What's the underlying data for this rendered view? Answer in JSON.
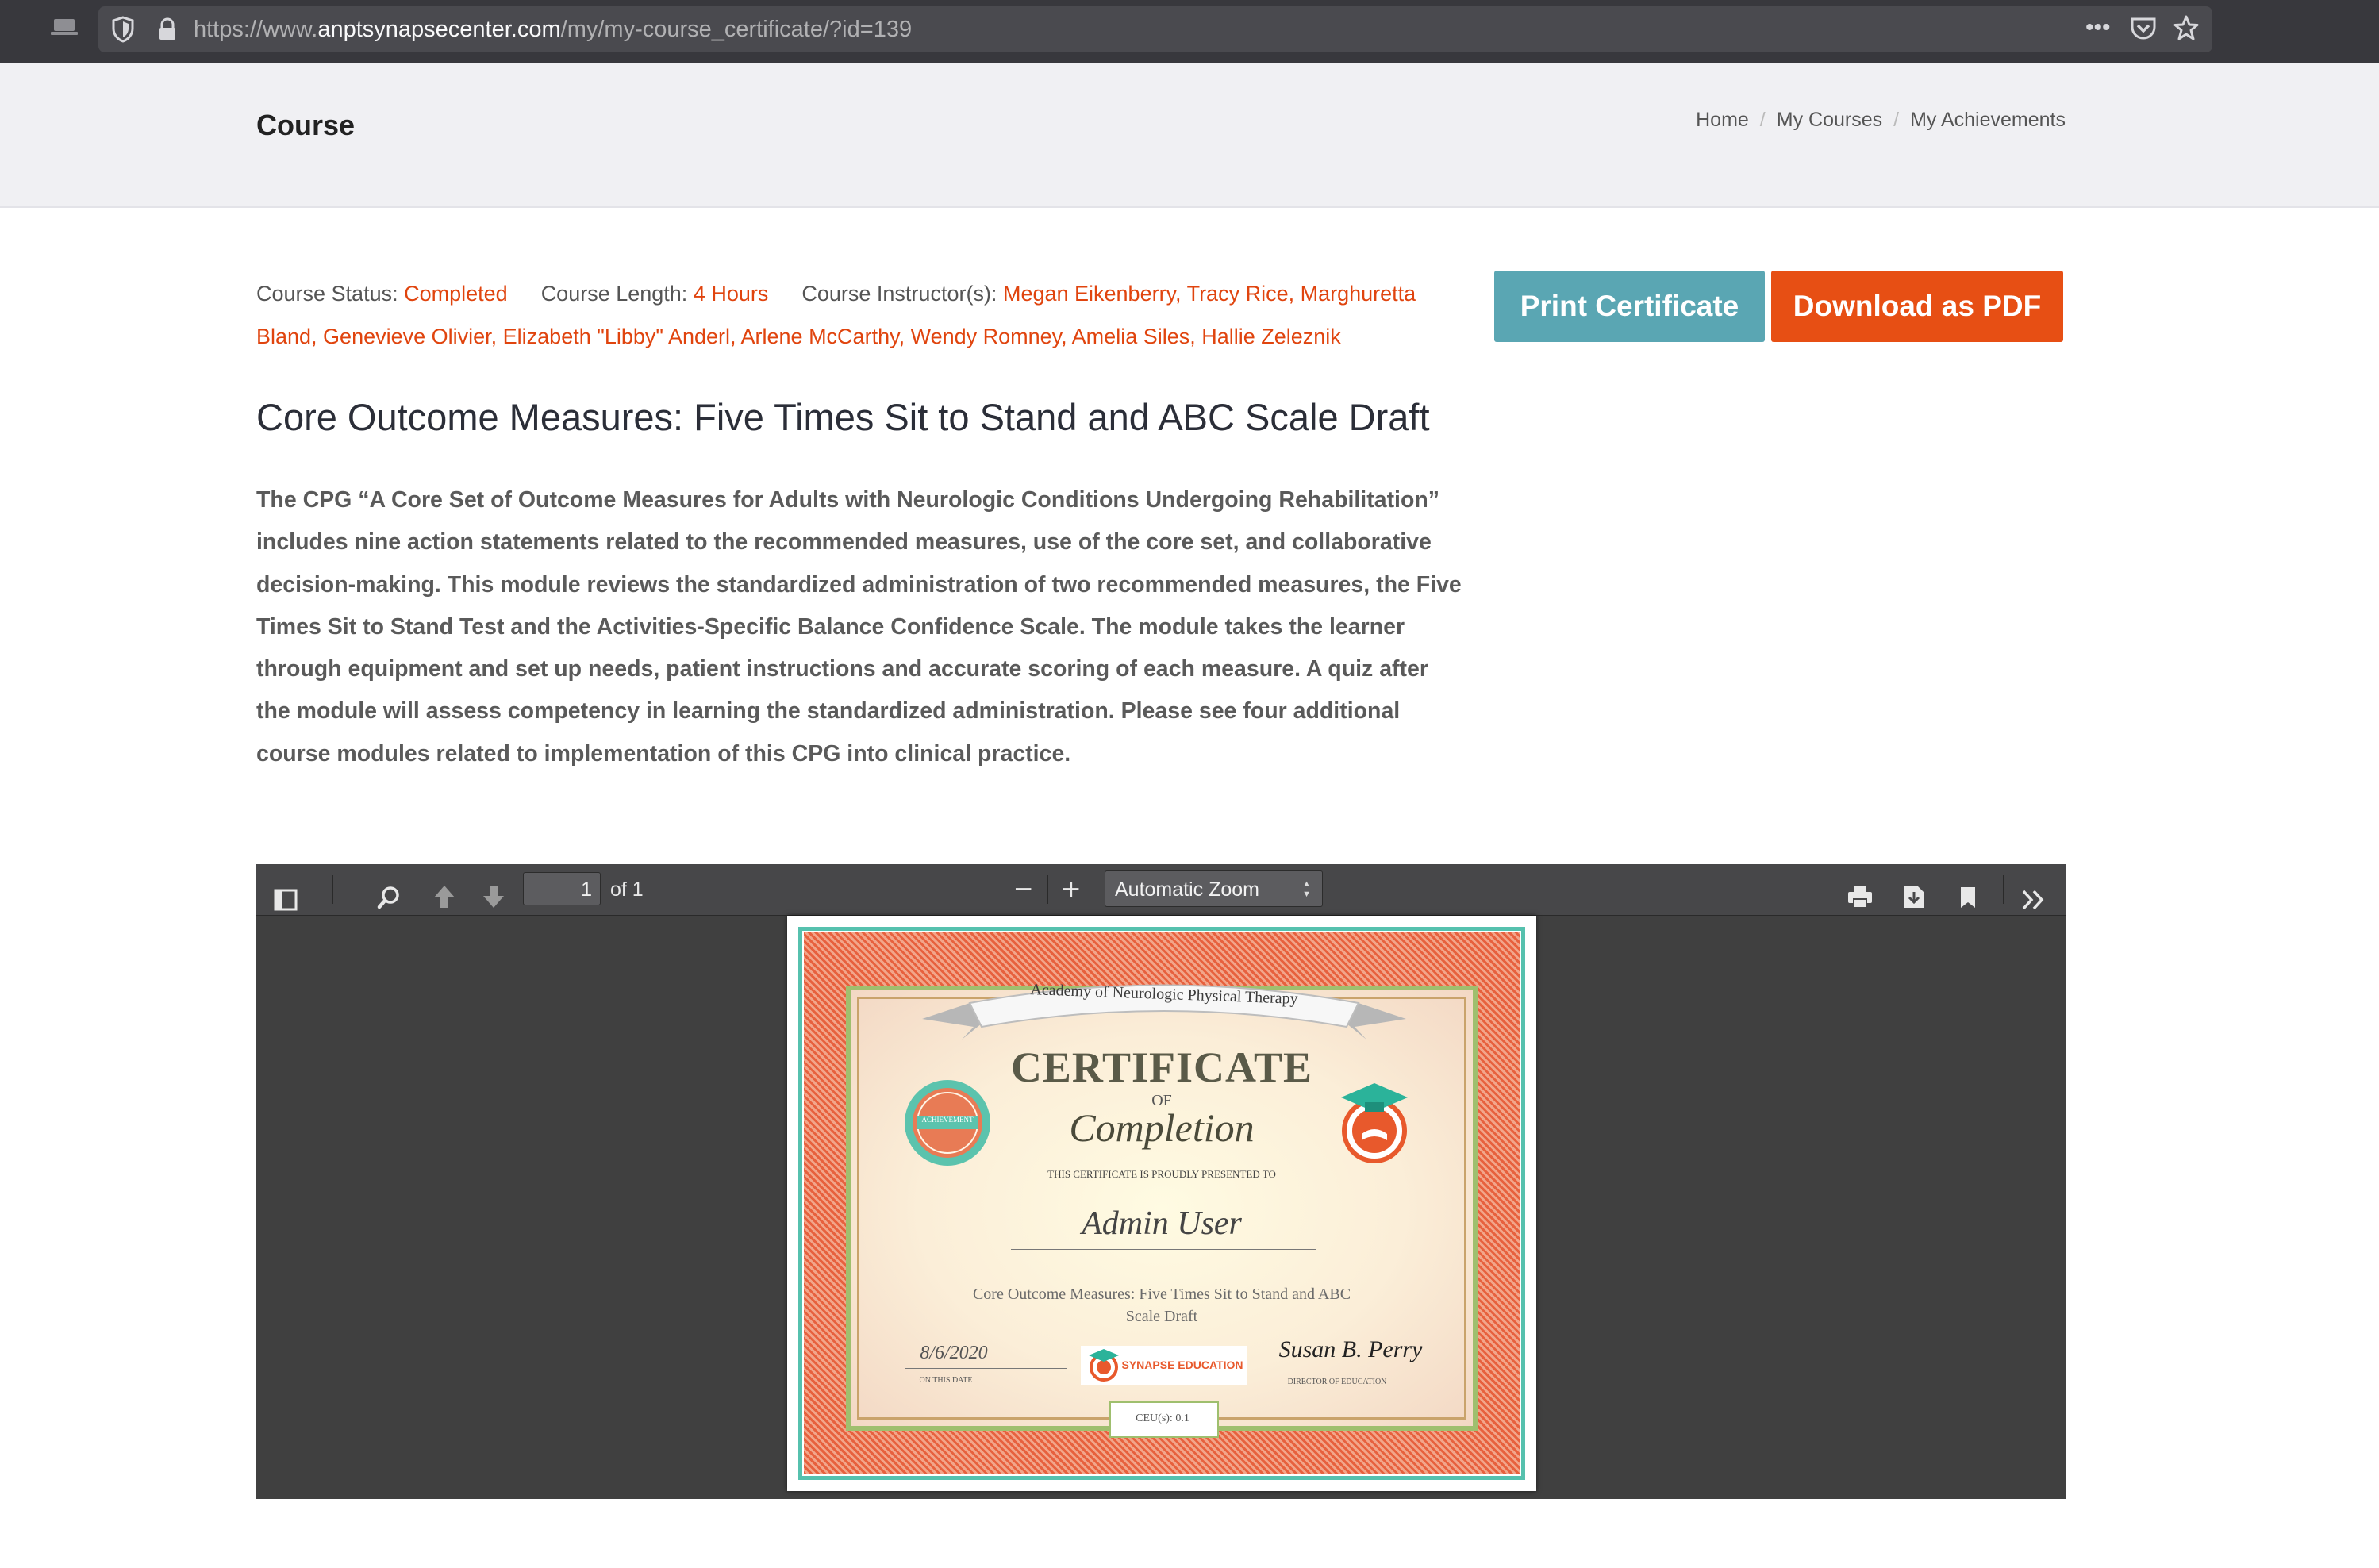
{
  "browser": {
    "url_scheme": "https://www.",
    "url_host": "anptsynapsecenter.com",
    "url_path": "/my/my-course_certificate/?id=139"
  },
  "header": {
    "title": "Course",
    "breadcrumb": [
      "Home",
      "My Courses",
      "My Achievements"
    ]
  },
  "meta": {
    "status_label": "Course Status:",
    "status_value": "Completed",
    "length_label": "Course Length:",
    "length_value": "4 Hours",
    "instructors_label": "Course Instructor(s):",
    "instructors_value": "Megan Eikenberry, Tracy Rice, Marghuretta Bland, Genevieve Olivier, Elizabeth \"Libby\" Anderl, Arlene McCarthy, Wendy Romney, Amelia Siles, Hallie Zeleznik"
  },
  "buttons": {
    "print": "Print Certificate",
    "pdf": "Download as PDF"
  },
  "course": {
    "title": "Core Outcome Measures: Five Times Sit to Stand and ABC Scale Draft",
    "description": "The CPG “A Core Set of Outcome Measures for Adults with Neurologic Conditions Undergoing Rehabilitation” includes nine action statements related to the recommended measures, use of the core set, and collaborative decision-making. This module reviews the standardized administration of two recommended measures, the Five Times Sit to Stand Test and the Activities-Specific Balance Confidence Scale. The module takes the learner through equipment and set up needs, patient instructions and accurate scoring of each measure. A quiz after the module will assess competency in learning the standardized administration. Please see four additional course modules related to implementation of this CPG into clinical practice."
  },
  "viewer": {
    "page_value": "1",
    "page_of": "of 1",
    "zoom": "Automatic Zoom"
  },
  "certificate": {
    "banner": "Academy of Neurologic Physical Therapy",
    "title": "CERTIFICATE",
    "of": "OF",
    "completion": "Completion",
    "presented": "THIS CERTIFICATE IS PROUDLY PRESENTED TO",
    "name": "Admin User",
    "course_line1": "Core Outcome Measures: Five Times Sit to Stand and ABC",
    "course_line2": "Scale Draft",
    "date": "8/6/2020",
    "date_label": "ON THIS DATE",
    "logo": "SYNAPSE EDUCATION",
    "signature": "Susan B. Perry",
    "sig_label": "DIRECTOR OF EDUCATION",
    "ceu": "CEU(s): 0.1",
    "seal": "ACHIEVEMENT"
  },
  "colors": {
    "accent_orange": "#e74f14",
    "accent_teal": "#5aa6b3",
    "link_orange": "#e0440e"
  }
}
